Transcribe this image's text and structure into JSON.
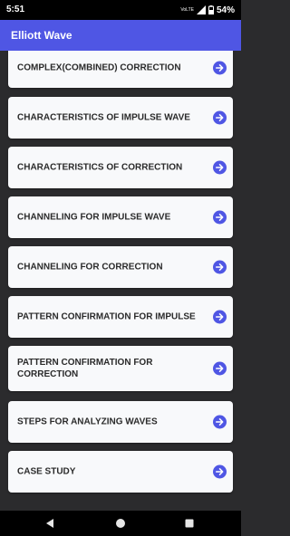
{
  "status_bar": {
    "time": "5:51",
    "network_label": "VoLTE",
    "battery": "54%"
  },
  "app_bar": {
    "title": "Elliott Wave"
  },
  "list": {
    "items": [
      {
        "label": "COMPLEX(COMBINED) CORRECTION"
      },
      {
        "label": "CHARACTERISTICS OF IMPULSE WAVE"
      },
      {
        "label": "CHARACTERISTICS OF CORRECTION"
      },
      {
        "label": "CHANNELING FOR IMPULSE WAVE"
      },
      {
        "label": "CHANNELING FOR CORRECTION"
      },
      {
        "label": "PATTERN CONFIRMATION FOR IMPULSE"
      },
      {
        "label": "PATTERN CONFIRMATION FOR CORRECTION"
      },
      {
        "label": "STEPS FOR ANALYZING WAVES"
      },
      {
        "label": "CASE STUDY"
      }
    ],
    "arrow_icon": "arrow-right-circle-icon"
  },
  "colors": {
    "app_bar": "#4f56e4",
    "background": "#2b2b2d",
    "card": "#f8f9fb",
    "arrow": "#4f56e4",
    "text": "#2a2a2a"
  }
}
